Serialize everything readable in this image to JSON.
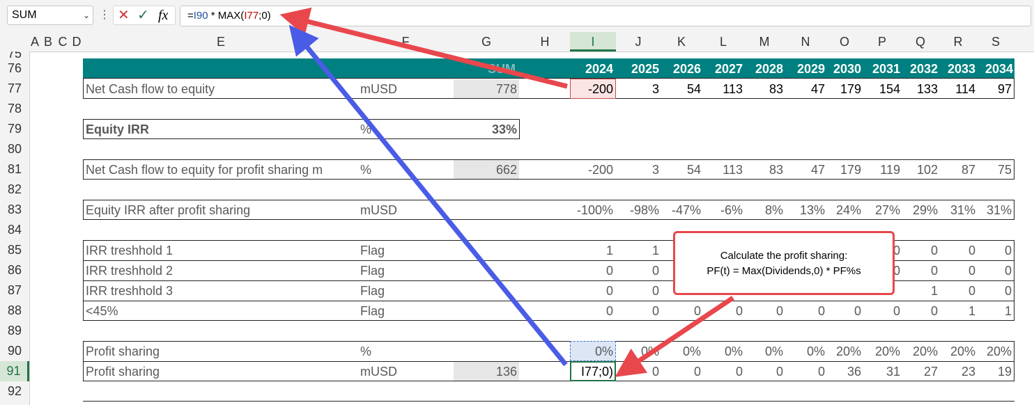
{
  "formula_bar": {
    "name_box": "SUM",
    "fx": "fx",
    "formula_prefix": "=",
    "ref1": "I90",
    "formula_mid": " * MAX(",
    "ref2": "I77",
    "formula_suffix": ";0)"
  },
  "columns": [
    "A",
    "B",
    "C",
    "D",
    "E",
    "F",
    "G",
    "H",
    "I",
    "J",
    "K",
    "L",
    "M",
    "N",
    "O",
    "P",
    "Q",
    "R",
    "S"
  ],
  "rows": [
    "75",
    "76",
    "77",
    "78",
    "79",
    "80",
    "81",
    "82",
    "83",
    "84",
    "85",
    "86",
    "87",
    "88",
    "89",
    "90",
    "91",
    "92"
  ],
  "header_row": {
    "sum_label": "SUM",
    "years": [
      "2024",
      "2025",
      "2026",
      "2027",
      "2028",
      "2029",
      "2030",
      "2031",
      "2032",
      "2033",
      "2034"
    ]
  },
  "table": [
    {
      "label": "Net Cash flow to equity",
      "unit": "mUSD",
      "sum": "778",
      "values": [
        "-200",
        "3",
        "54",
        "113",
        "83",
        "47",
        "179",
        "154",
        "133",
        "114",
        "97"
      ]
    },
    {
      "label": "Equity IRR",
      "unit": "%",
      "sum": "33%"
    },
    {
      "label": "Net Cash flow to equity for profit sharing m",
      "unit": "%",
      "sum": "662",
      "values": [
        "-200",
        "3",
        "54",
        "113",
        "83",
        "47",
        "179",
        "119",
        "102",
        "87",
        "75"
      ]
    },
    {
      "label": "Equity IRR after profit sharing",
      "unit": "mUSD",
      "values": [
        "-100%",
        "-98%",
        "-47%",
        "-6%",
        "8%",
        "13%",
        "24%",
        "27%",
        "29%",
        "31%",
        "31%"
      ]
    },
    {
      "label": "IRR treshhold 1",
      "unit": "Flag",
      "values": [
        "1",
        "1",
        "",
        "",
        "",
        "",
        "",
        "0",
        "0",
        "0",
        "0"
      ]
    },
    {
      "label": "IRR treshhold 2",
      "unit": "Flag",
      "values": [
        "0",
        "0",
        "",
        "",
        "",
        "",
        "",
        "0",
        "0",
        "0",
        "0"
      ]
    },
    {
      "label": "IRR treshhold 3",
      "unit": "Flag",
      "values": [
        "0",
        "0",
        "",
        "",
        "",
        "",
        "",
        "",
        "1",
        "0",
        "0"
      ]
    },
    {
      "label": "<45%",
      "unit": "Flag",
      "values": [
        "0",
        "0",
        "0",
        "0",
        "0",
        "0",
        "0",
        "0",
        "0",
        "1",
        "1"
      ]
    },
    {
      "label": "Profit sharing",
      "unit": "%",
      "values": [
        "0%",
        "0%",
        "0%",
        "0%",
        "0%",
        "0%",
        "20%",
        "20%",
        "20%",
        "20%",
        "20%"
      ]
    },
    {
      "label": "Profit sharing",
      "unit": "mUSD",
      "sum": "136",
      "values": [
        "I77;0)",
        "0",
        "0",
        "0",
        "0",
        "0",
        "36",
        "31",
        "27",
        "23",
        "19"
      ]
    }
  ],
  "callout": {
    "line1": "Calculate the profit sharing:",
    "line2": "PF(t) = Max(Dividends,0) * PF%s"
  },
  "colors": {
    "header_teal": "#008080",
    "arrow_red": "#e8474c",
    "arrow_blue": "#4a5ce6",
    "selection_green": "#217346"
  }
}
